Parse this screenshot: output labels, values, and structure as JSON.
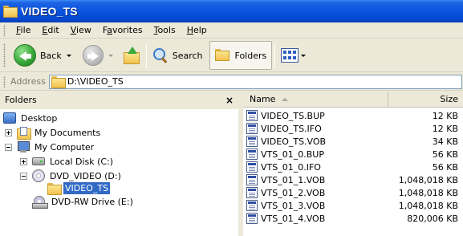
{
  "window": {
    "title": "VIDEO_TS"
  },
  "menubar": {
    "items": [
      {
        "accel": "F",
        "rest": "ile"
      },
      {
        "accel": "E",
        "rest": "dit"
      },
      {
        "accel": "V",
        "rest": "iew"
      },
      {
        "accel": "",
        "rest": "Favorites",
        "pre": "F",
        "u": "a",
        "post": "vorites"
      },
      {
        "accel": "T",
        "rest": "ools"
      },
      {
        "accel": "H",
        "rest": "elp"
      }
    ]
  },
  "toolbar": {
    "back_label": "Back",
    "search_label": "Search",
    "folders_label": "Folders"
  },
  "address": {
    "label": "Address",
    "value": "D:\\VIDEO_TS"
  },
  "folders": {
    "header": "Folders",
    "close_glyph": "×",
    "tree": [
      {
        "label": "Desktop"
      },
      {
        "label": "My Documents"
      },
      {
        "label": "My Computer"
      },
      {
        "label": "Local Disk (C:)"
      },
      {
        "label": "DVD_VIDEO (D:)"
      },
      {
        "label": "VIDEO_TS",
        "selected": true
      },
      {
        "label": "DVD-RW Drive (E:)"
      }
    ]
  },
  "list": {
    "columns": {
      "name": "Name",
      "size": "Size"
    },
    "files": [
      {
        "name": "VIDEO_TS.BUP",
        "size": "12 KB"
      },
      {
        "name": "VIDEO_TS.IFO",
        "size": "12 KB"
      },
      {
        "name": "VIDEO_TS.VOB",
        "size": "34 KB"
      },
      {
        "name": "VTS_01_0.BUP",
        "size": "56 KB"
      },
      {
        "name": "VTS_01_0.IFO",
        "size": "56 KB"
      },
      {
        "name": "VTS_01_1.VOB",
        "size": "1,048,018 KB"
      },
      {
        "name": "VTS_01_2.VOB",
        "size": "1,048,018 KB"
      },
      {
        "name": "VTS_01_3.VOB",
        "size": "1,048,018 KB"
      },
      {
        "name": "VTS_01_4.VOB",
        "size": "820,006 KB"
      }
    ]
  },
  "colors": {
    "titlebar": "#0a54df",
    "selection": "#316ac5",
    "chrome": "#ece9d8"
  }
}
